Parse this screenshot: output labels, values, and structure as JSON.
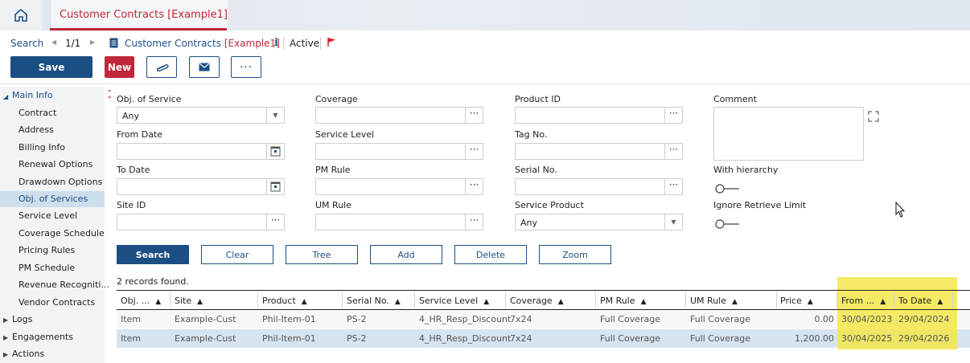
{
  "header": {
    "tab_title": "Customer Contracts [Example1]"
  },
  "breadcrumb": {
    "search": "Search",
    "pager": "1/1",
    "record": "Customer Contracts",
    "record_suffix": "[Example1]",
    "status": "Active"
  },
  "toolbar": {
    "save": "Save",
    "new": "New",
    "more": "···"
  },
  "sidebar": {
    "main_info": "Main Info",
    "items": [
      "Contract",
      "Address",
      "Billing Info",
      "Renewal Options",
      "Drawdown Options",
      "Obj. of Services",
      "Service Level",
      "Coverage Schedule",
      "Pricing Rules",
      "PM Schedule",
      "Revenue Recogniti...",
      "Vendor Contracts"
    ],
    "selected": "Obj. of Services",
    "groups": [
      "Logs",
      "Engagements",
      "Actions"
    ]
  },
  "form": {
    "obj_of_service": {
      "label": "Obj. of Service",
      "value": "Any"
    },
    "from_date": {
      "label": "From Date",
      "value": ""
    },
    "to_date": {
      "label": "To Date",
      "value": ""
    },
    "site_id": {
      "label": "Site ID",
      "value": ""
    },
    "coverage": {
      "label": "Coverage",
      "value": ""
    },
    "service_level": {
      "label": "Service Level",
      "value": ""
    },
    "pm_rule": {
      "label": "PM Rule",
      "value": ""
    },
    "um_rule": {
      "label": "UM Rule",
      "value": ""
    },
    "product_id": {
      "label": "Product ID",
      "value": ""
    },
    "tag_no": {
      "label": "Tag No.",
      "value": ""
    },
    "serial_no": {
      "label": "Serial No.",
      "value": ""
    },
    "service_product": {
      "label": "Service Product",
      "value": "Any"
    },
    "comment": {
      "label": "Comment",
      "value": ""
    },
    "with_hierarchy": {
      "label": "With hierarchy",
      "on": false
    },
    "ignore_limit": {
      "label": "Ignore Retrieve Limit",
      "on": false
    }
  },
  "actions": {
    "search": "Search",
    "clear": "Clear",
    "tree": "Tree",
    "add": "Add",
    "delete": "Delete",
    "zoom": "Zoom"
  },
  "results": {
    "count_text": "2 records found.",
    "columns": [
      "Obj. ...",
      "Site",
      "Product",
      "Serial No.",
      "Service Level",
      "Coverage",
      "PM Rule",
      "UM Rule",
      "Price",
      "From ...",
      "To Date"
    ],
    "sort_arrow": "▲",
    "rows": [
      [
        "Item",
        "Example-Cust",
        "Phil-Item-01",
        "PS-2",
        "4_HR_Resp_Discount",
        "7x24",
        "Full Coverage",
        "Full Coverage",
        "0.00",
        "30/04/2023",
        "29/04/2024"
      ],
      [
        "Item",
        "Example-Cust",
        "Phil-Item-01",
        "PS-2",
        "4_HR_Resp_Discount",
        "7x24",
        "Full Coverage",
        "Full Coverage",
        "1,200.00",
        "30/04/2025",
        "29/04/2026"
      ]
    ]
  },
  "colors": {
    "brand_blue": "#1b4f83",
    "accent_red": "#c0273b",
    "highlight": "#f3e64a",
    "selected_row": "#d6e4ef"
  }
}
